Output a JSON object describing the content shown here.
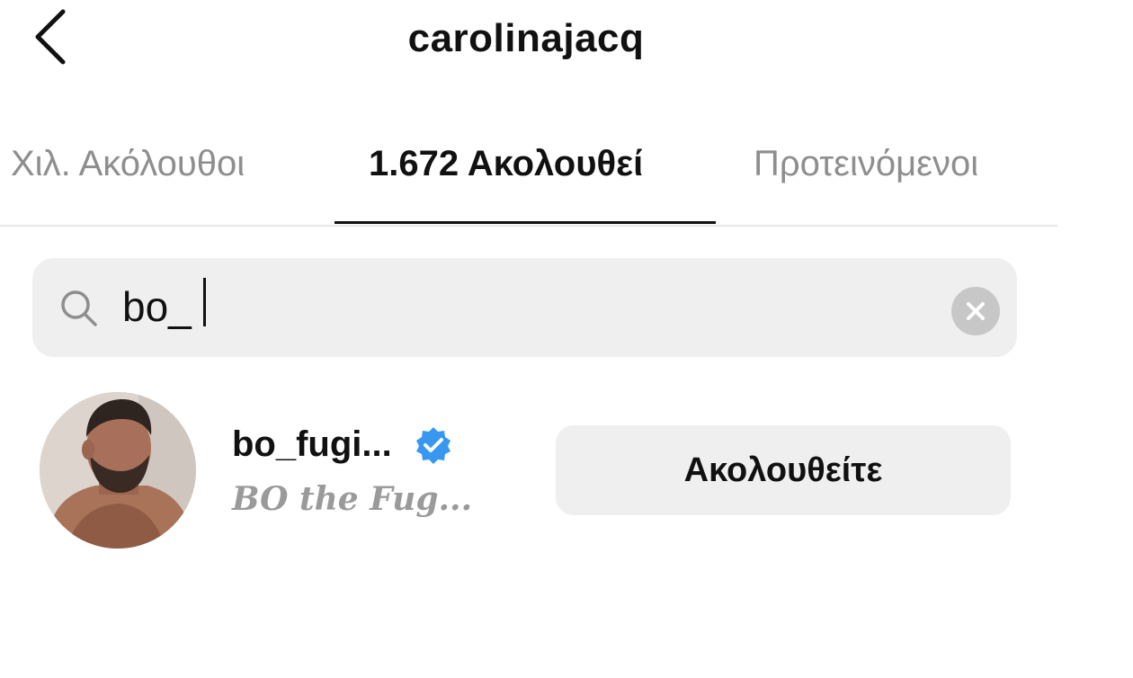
{
  "header": {
    "title": "carolinajacq",
    "back_icon": "chevron-left-icon"
  },
  "tabs": [
    {
      "label": "Χιλ. Ακόλουθοι",
      "active": false
    },
    {
      "label": "1.672 Ακολουθεί",
      "active": true
    },
    {
      "label": "Προτεινόμενοι",
      "active": false
    }
  ],
  "search": {
    "icon": "search-icon",
    "value": "bo_",
    "clear_icon": "clear-icon"
  },
  "results": [
    {
      "username": "bo_fugi...",
      "verified": true,
      "full_name": "BO the Fug...",
      "button_label": "Ακολουθείτε"
    }
  ],
  "colors": {
    "verified_badge": "#3897f0",
    "inactive_tab": "#8e8e8e",
    "search_bg": "#efefef",
    "button_bg": "#efefef",
    "secondary_text": "#9a9a9a"
  }
}
